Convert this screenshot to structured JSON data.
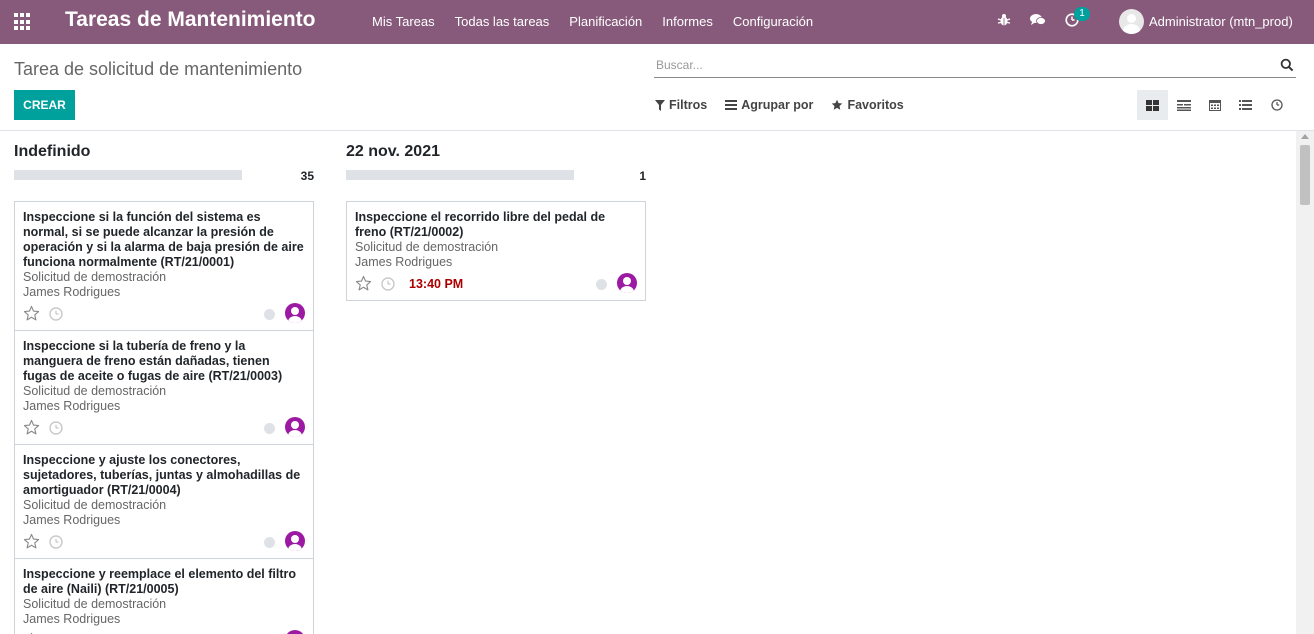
{
  "app": {
    "title": "Tareas de Mantenimiento",
    "menu": [
      "Mis Tareas",
      "Todas las tareas",
      "Planificación",
      "Informes",
      "Configuración"
    ],
    "activity_badge": "1",
    "user": "Administrator (mtn_prod)"
  },
  "control": {
    "breadcrumb": "Tarea de solicitud de mantenimiento",
    "search_placeholder": "Buscar...",
    "create_label": "CREAR",
    "filters_label": "Filtros",
    "group_by_label": "Agrupar por",
    "favorites_label": "Favoritos"
  },
  "columns": [
    {
      "title": "Indefinido",
      "count": "35",
      "cards": [
        {
          "title": "Inspeccione si la función del sistema es normal, si se puede alcanzar la presión de operación y si la alarma de baja presión de aire funciona normalmente (RT/21/0001)",
          "request": "Solicitud de demostración",
          "assignee": "James Rodrigues",
          "deadline": ""
        },
        {
          "title": "Inspeccione si la tubería de freno y la manguera de freno están dañadas, tienen fugas de aceite o fugas de aire (RT/21/0003)",
          "request": "Solicitud de demostración",
          "assignee": "James Rodrigues",
          "deadline": ""
        },
        {
          "title": "Inspeccione y ajuste los conectores, sujetadores, tuberías, juntas y almohadillas de amortiguador (RT/21/0004)",
          "request": "Solicitud de demostración",
          "assignee": "James Rodrigues",
          "deadline": ""
        },
        {
          "title": "Inspeccione y reemplace el elemento del filtro de aire (Naili) (RT/21/0005)",
          "request": "Solicitud de demostración",
          "assignee": "James Rodrigues",
          "deadline": ""
        }
      ]
    },
    {
      "title": "22 nov. 2021",
      "count": "1",
      "cards": [
        {
          "title": "Inspeccione el recorrido libre del pedal de freno (RT/21/0002)",
          "request": "Solicitud de demostración",
          "assignee": "James Rodrigues",
          "deadline": "13:40 PM"
        }
      ]
    }
  ],
  "colors": {
    "topbar": "#875a7b",
    "primary": "#00a09d",
    "avatar": "#9c1aa3",
    "deadline": "#aa0000"
  }
}
